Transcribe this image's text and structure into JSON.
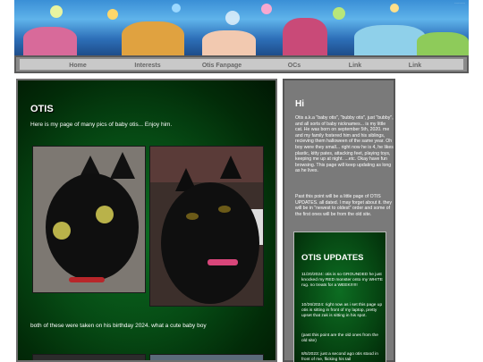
{
  "banner": {
    "corner_link": "---------"
  },
  "nav": {
    "items": [
      "Home",
      "Interests",
      "Otis Fanpage",
      "OCs",
      "Link",
      "Link"
    ]
  },
  "main": {
    "title": "OTIS",
    "intro": "Here is my page of many pics of baby otis... Enjoy him.",
    "caption": "both of these were taken on his birthday 2024. what a cute baby boy"
  },
  "side": {
    "title": "Hi",
    "about": "Otis a.k.a \"baby otis\", \"bubby otis\", just \"bubby\", and all sorts of baby nicknames... is my little cat. He was born on september 5th, 2020. me and my family fostered him and his siblings, recieving them halloween of the same year. Oh boy were they small... right now he is 4, he likes plastic, kitty pates, attacking feet, playing toys, keeping me up at night. ...etc. Okay have fun browsing. This page will keep updating as long as he lives.",
    "note": "Past this point will be a little page of OTIS UPDATES. all dated. I may forget about it. they will be in \"newest to oldest\" order and some of the first ones will be from the old site."
  },
  "updates": {
    "title": "OTIS UPDATES",
    "entries": [
      "11/20/2024: otis is so GROUNDED he just knocked my RED monster onto my WHITE rug. no treats for a WEEK!!!!!!",
      "10/26/2024: right now as i set this page up otis is sitting in front of my laptop, pretty upset that zak is sitting in his spot.",
      "(past this point are the old ones from the old site)",
      "8/5/2023: just a second ago otis stood in front of me, flicking his tail"
    ]
  },
  "colors": {
    "main_bg": "#064a14",
    "side_bg": "#7a7a7a",
    "nav_bg": "#c9c9c9",
    "nav_text": "#666666"
  }
}
